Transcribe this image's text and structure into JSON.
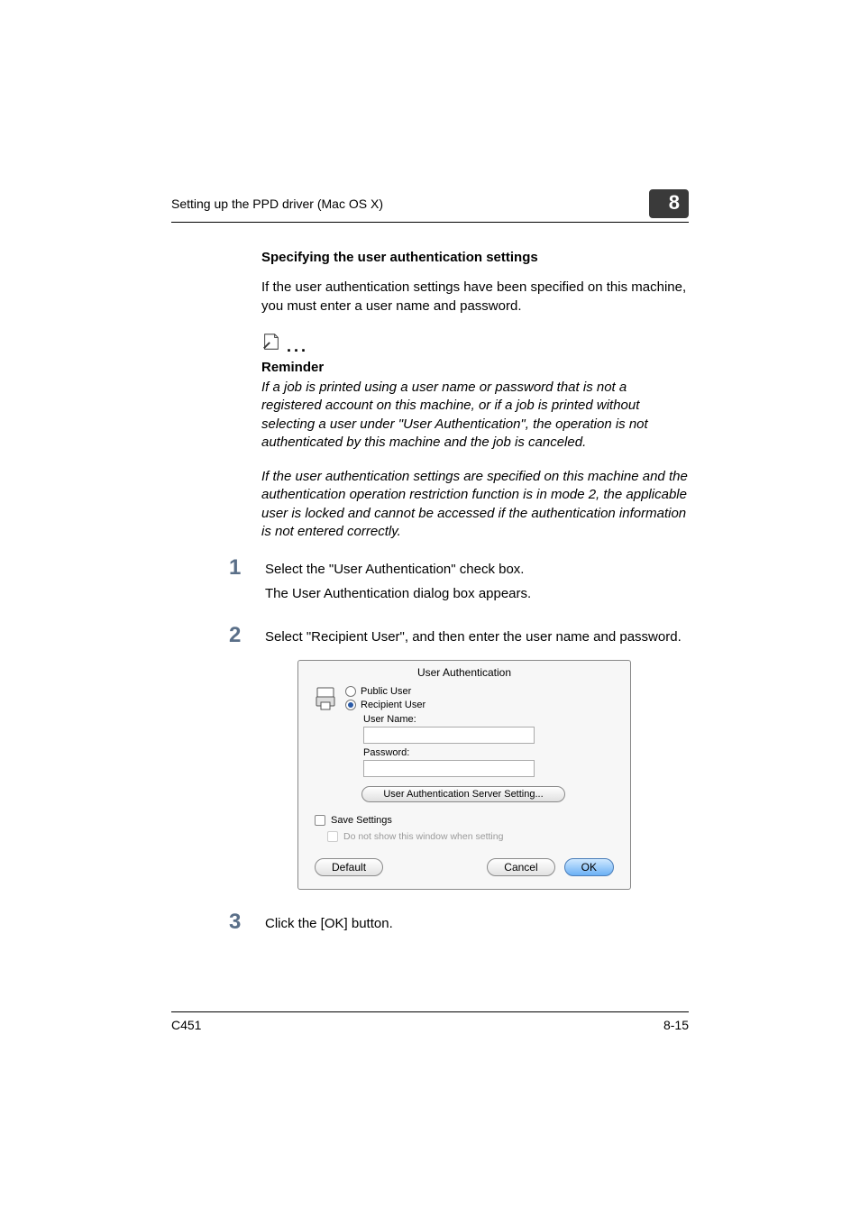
{
  "header": {
    "text": "Setting up the PPD driver (Mac OS X)",
    "chapter": "8"
  },
  "section_title": "Specifying the user authentication settings",
  "intro": "If the user authentication settings have been specified on this machine, you must enter a user name and password.",
  "reminder": {
    "label": "Reminder",
    "p1": "If a job is printed using a user name or password that is not a registered account on this machine, or if a job is printed without selecting a user under \"User Authentication\", the operation is not authenticated by this machine and the job is canceled.",
    "p2": "If the user authentication settings are specified on this machine and the authentication operation restriction function is in mode 2, the applicable user is locked and cannot be accessed if the authentication information is not entered correctly."
  },
  "steps": {
    "s1_num": "1",
    "s1_text": "Select the \"User Authentication\" check box.",
    "s1_sub": "The User Authentication dialog box appears.",
    "s2_num": "2",
    "s2_text": "Select \"Recipient User\", and then enter the user name and password.",
    "s3_num": "3",
    "s3_text": "Click the [OK] button."
  },
  "dialog": {
    "title": "User Authentication",
    "public_user": "Public User",
    "recipient_user": "Recipient User",
    "username_label": "User Name:",
    "password_label": "Password:",
    "server_setting": "User Authentication Server Setting...",
    "save_settings": "Save Settings",
    "do_not_show": "Do not show this window when setting",
    "default_btn": "Default",
    "cancel_btn": "Cancel",
    "ok_btn": "OK"
  },
  "footer": {
    "model": "C451",
    "page": "8-15"
  }
}
